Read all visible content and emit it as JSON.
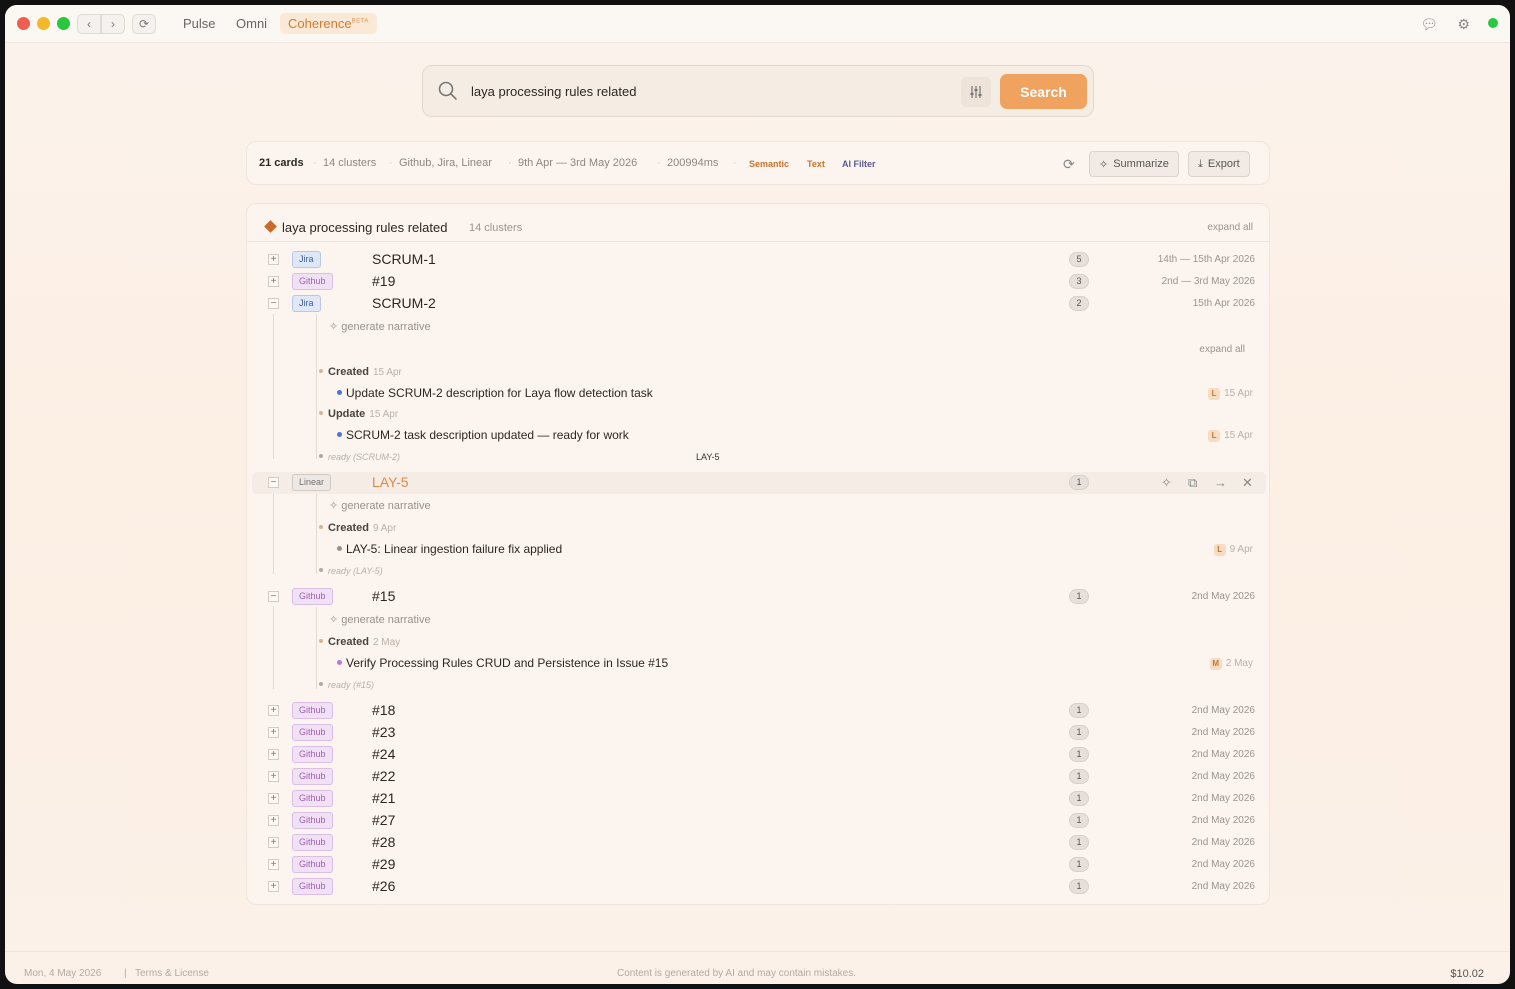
{
  "nav": {
    "tabs": [
      "Pulse",
      "Omni",
      "Coherence"
    ],
    "active_badge": "BETA"
  },
  "colors": {
    "accent": "#f0a25f",
    "close": "#ee5f4f",
    "minimize": "#f3b82c",
    "zoom": "#27c73f",
    "status": "#28c840"
  },
  "search": {
    "value": "laya processing rules related",
    "button": "Search"
  },
  "stats": {
    "cards": "21 cards",
    "clusters": "14 clusters",
    "sources": "Github, Jira, Linear",
    "range": "9th Apr — 3rd May 2026",
    "time": "200994ms",
    "modes": [
      "Semantic",
      "Text",
      "AI Filter"
    ],
    "summarize": "Summarize",
    "export": "Export"
  },
  "panel": {
    "title": "laya processing rules related",
    "count": "14 clusters",
    "expand": "expand all"
  },
  "rows": [
    {
      "src": "Jira",
      "label": "SCRUM-1",
      "count": "5",
      "date": "14th — 15th Apr 2026",
      "toggle": "+"
    },
    {
      "src": "Github",
      "label": "#19",
      "count": "3",
      "date": "2nd — 3rd May 2026",
      "toggle": "+"
    },
    {
      "src": "Jira",
      "label": "SCRUM-2",
      "count": "2",
      "date": "15th Apr 2026",
      "toggle": "−"
    },
    {
      "src": "Linear",
      "label": "LAY-5",
      "count": "1",
      "date": "",
      "toggle": "−"
    },
    {
      "src": "Github",
      "label": "#15",
      "count": "1",
      "date": "2nd May 2026",
      "toggle": "−"
    },
    {
      "src": "Github",
      "label": "#18",
      "count": "1",
      "date": "2nd May 2026",
      "toggle": "+"
    },
    {
      "src": "Github",
      "label": "#23",
      "count": "1",
      "date": "2nd May 2026",
      "toggle": "+"
    },
    {
      "src": "Github",
      "label": "#24",
      "count": "1",
      "date": "2nd May 2026",
      "toggle": "+"
    },
    {
      "src": "Github",
      "label": "#22",
      "count": "1",
      "date": "2nd May 2026",
      "toggle": "+"
    },
    {
      "src": "Github",
      "label": "#21",
      "count": "1",
      "date": "2nd May 2026",
      "toggle": "+"
    },
    {
      "src": "Github",
      "label": "#27",
      "count": "1",
      "date": "2nd May 2026",
      "toggle": "+"
    },
    {
      "src": "Github",
      "label": "#28",
      "count": "1",
      "date": "2nd May 2026",
      "toggle": "+"
    },
    {
      "src": "Github",
      "label": "#29",
      "count": "1",
      "date": "2nd May 2026",
      "toggle": "+"
    },
    {
      "src": "Github",
      "label": "#26",
      "count": "1",
      "date": "2nd May 2026",
      "toggle": "+"
    }
  ],
  "scrum2": {
    "narrative": "generate narrative",
    "expand": "expand all",
    "events": [
      {
        "type": "Created",
        "date": "15 Apr",
        "item": "Update SCRUM-2 description for Laya flow detection task",
        "avatar": "L",
        "idate": "15 Apr"
      },
      {
        "type": "Update",
        "date": "15 Apr",
        "item": "SCRUM-2 task description updated — ready for work",
        "avatar": "L",
        "idate": "15 Apr"
      }
    ],
    "ready": "ready (SCRUM-2)"
  },
  "tooltip": "LAY-5",
  "lay5": {
    "narrative": "generate narrative",
    "events": [
      {
        "type": "Created",
        "date": "9 Apr",
        "item": "LAY-5: Linear ingestion failure fix applied",
        "avatar": "L",
        "idate": "9 Apr"
      }
    ],
    "ready": "ready (LAY-5)"
  },
  "gh15": {
    "narrative": "generate narrative",
    "events": [
      {
        "type": "Created",
        "date": "2 May",
        "item": "Verify Processing Rules CRUD and Persistence in Issue #15",
        "avatar": "M",
        "idate": "2 May"
      }
    ],
    "ready": "ready (#15)"
  },
  "footer": {
    "date": "Mon, 4 May 2026",
    "terms": "Terms & License",
    "disclaimer": "Content is generated by AI and may contain mistakes.",
    "cost": "$10.02"
  }
}
